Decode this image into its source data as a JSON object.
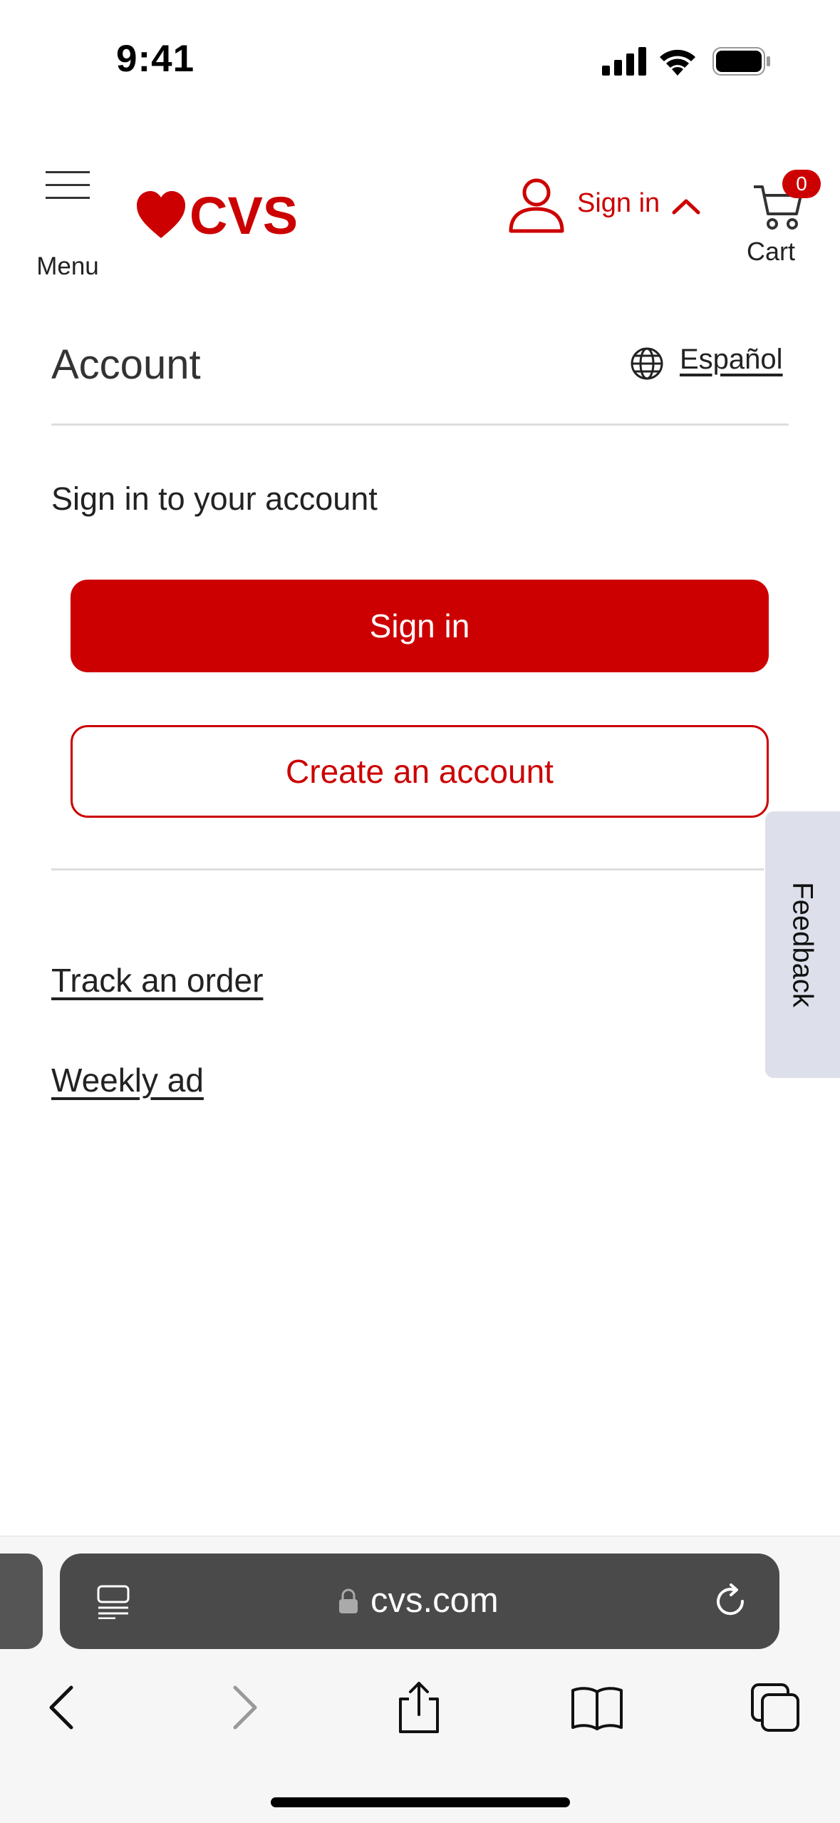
{
  "status_bar": {
    "time": "9:41"
  },
  "header": {
    "menu_label": "Menu",
    "logo_text": "CVS",
    "account_label": "Sign in",
    "cart_label": "Cart",
    "cart_count": "0"
  },
  "main": {
    "title": "Account",
    "language_link": "Español",
    "subtitle": "Sign in to your account",
    "sign_in_button": "Sign in",
    "create_account_button": "Create an account",
    "links": [
      "Track an order",
      "Weekly ad"
    ]
  },
  "feedback": {
    "label": "Feedback"
  },
  "browser": {
    "url": "cvs.com"
  },
  "colors": {
    "brand_red": "#cc0000",
    "feedback_bg": "#dde0ea",
    "url_bar_bg": "#4a4a4a"
  },
  "icons": [
    "signal-icon",
    "wifi-icon",
    "battery-icon",
    "hamburger-icon",
    "cvs-heart-logo",
    "user-icon",
    "chevron-up-icon",
    "cart-icon",
    "globe-icon",
    "reader-icon",
    "lock-icon",
    "reload-icon",
    "back-icon",
    "forward-icon",
    "share-icon",
    "bookmarks-icon",
    "tabs-icon"
  ]
}
